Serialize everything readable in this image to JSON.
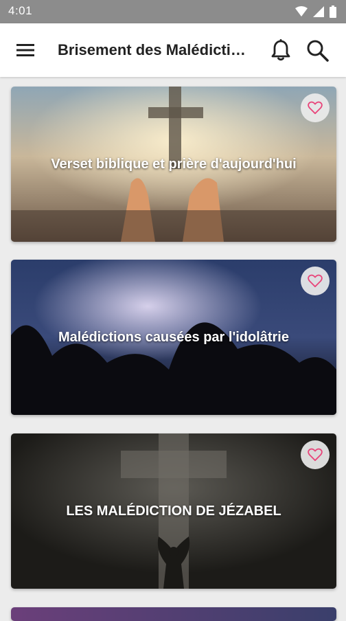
{
  "status_bar": {
    "time": "4:01",
    "icons": [
      "wifi-icon",
      "signal-icon",
      "battery-icon"
    ]
  },
  "app_bar": {
    "title": "Brisement des Malédicti…",
    "icons": [
      "menu-icon",
      "bell-icon",
      "search-icon"
    ]
  },
  "cards": [
    {
      "title": "Verset biblique et prière d'aujourd'hui",
      "favorite_icon": "heart-outline-icon"
    },
    {
      "title": "Malédictions causées par l'idolâtrie",
      "favorite_icon": "heart-outline-icon"
    },
    {
      "title": "LES MALÉDICTION DE JÉZABEL",
      "favorite_icon": "heart-outline-icon"
    }
  ],
  "colors": {
    "status_bar": "#8c8c8c",
    "app_bar": "#ffffff",
    "background": "#ececec",
    "heart": "#e8457a"
  }
}
